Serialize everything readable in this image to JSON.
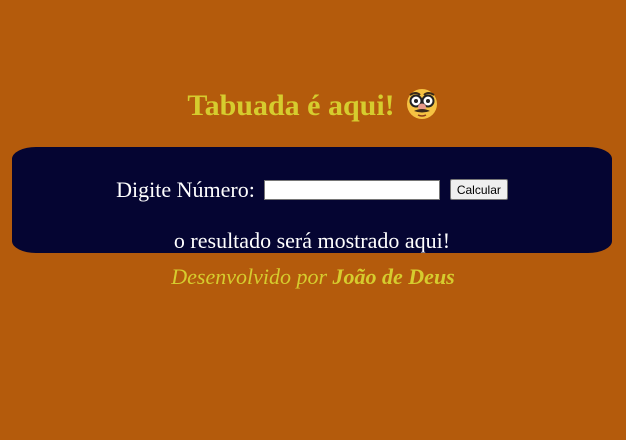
{
  "header": {
    "title": "Tabuada é aqui!",
    "emoji_icon": "disguised-face-icon"
  },
  "form": {
    "label": "Digite Número:",
    "input_value": "",
    "button_label": "Calcular"
  },
  "result": {
    "text": "o resultado será mostrado aqui!"
  },
  "footer": {
    "prefix": "Desenvolvido por",
    "author": "João de Deus"
  },
  "colors": {
    "background": "#b45b0c",
    "panel": "#050532",
    "accent": "#d6cc2e",
    "text": "#ffffff"
  }
}
